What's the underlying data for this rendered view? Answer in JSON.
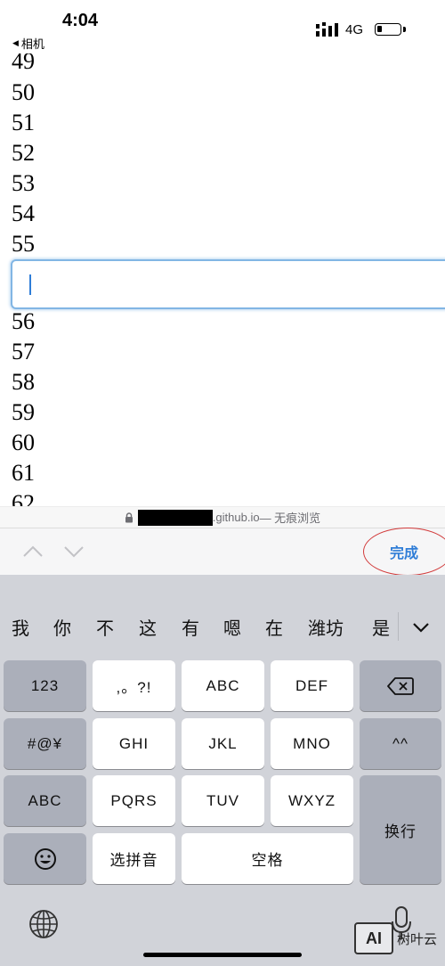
{
  "status_bar": {
    "time": "4:04",
    "back_app": "相机",
    "network": "4G"
  },
  "content": {
    "numbers_above": [
      "49",
      "50",
      "51",
      "52",
      "53",
      "54",
      "55"
    ],
    "numbers_below": [
      "56",
      "57",
      "58",
      "59",
      "60",
      "61",
      "62"
    ],
    "input_value": ""
  },
  "url_bar": {
    "domain_suffix": ".github.io",
    "mode": " — 无痕浏览"
  },
  "accessory": {
    "done_label": "完成"
  },
  "keyboard": {
    "candidates": [
      "我",
      "你",
      "不",
      "这",
      "有",
      "嗯",
      "在",
      "潍坊",
      "是"
    ],
    "rows": [
      [
        "123",
        ",。?!",
        "ABC",
        "DEF"
      ],
      [
        "#@¥",
        "GHI",
        "JKL",
        "MNO",
        "^^"
      ],
      [
        "ABC",
        "PQRS",
        "TUV",
        "WXYZ",
        "换行"
      ],
      [
        "选拼音",
        "空格"
      ]
    ]
  },
  "watermark": {
    "logo": "AI",
    "text": "树叶云"
  },
  "colors": {
    "accent": "#2f7dd7",
    "keyboard_bg": "#d1d3d9",
    "key_dark": "#abafba",
    "annotation_red": "#d23b3b"
  }
}
